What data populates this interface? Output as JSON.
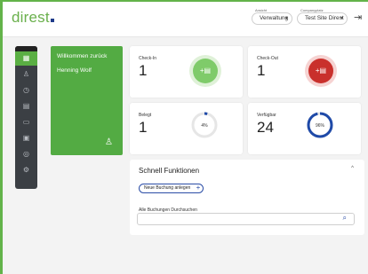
{
  "app": {
    "logo": "direst"
  },
  "header": {
    "view_label": "Ansicht",
    "view_value": "Verwaltung",
    "company_label": "Companyplatz",
    "company_value": "Test Site Direst"
  },
  "sidebar": {
    "items": [
      {
        "icon": "grid-icon",
        "glyph": "▦",
        "active": true
      },
      {
        "icon": "person-icon",
        "glyph": "♙",
        "active": false
      },
      {
        "icon": "clock-icon",
        "glyph": "◷",
        "active": false
      },
      {
        "icon": "document-icon",
        "glyph": "▤",
        "active": false
      },
      {
        "icon": "card-icon",
        "glyph": "▭",
        "active": false
      },
      {
        "icon": "calendar-icon",
        "glyph": "▣",
        "active": false
      },
      {
        "icon": "coin-icon",
        "glyph": "◎",
        "active": false
      },
      {
        "icon": "settings-icon",
        "glyph": "⚙",
        "active": false
      }
    ]
  },
  "welcome": {
    "greeting": "Willkommen zurück",
    "user_name": "Henning Wolf"
  },
  "stats": {
    "checkin": {
      "label": "Check-In",
      "value": "1"
    },
    "checkout": {
      "label": "Check-Out",
      "value": "1"
    },
    "occupied": {
      "label": "Belegt",
      "value": "1",
      "percent_text": "4%",
      "percent": 4
    },
    "available": {
      "label": "Verfügbar",
      "value": "24",
      "percent_text": "96%",
      "percent": 96
    }
  },
  "quick": {
    "title": "Schnell Funktionen",
    "new_booking": "Neue Buchung anlegen",
    "search_label": "Alle Buchungen Durchsuchen",
    "search_value": ""
  },
  "colors": {
    "green": "#53ab43",
    "red": "#c9302c",
    "blue": "#1f4aa8",
    "light_green": "#7fcb6a"
  }
}
